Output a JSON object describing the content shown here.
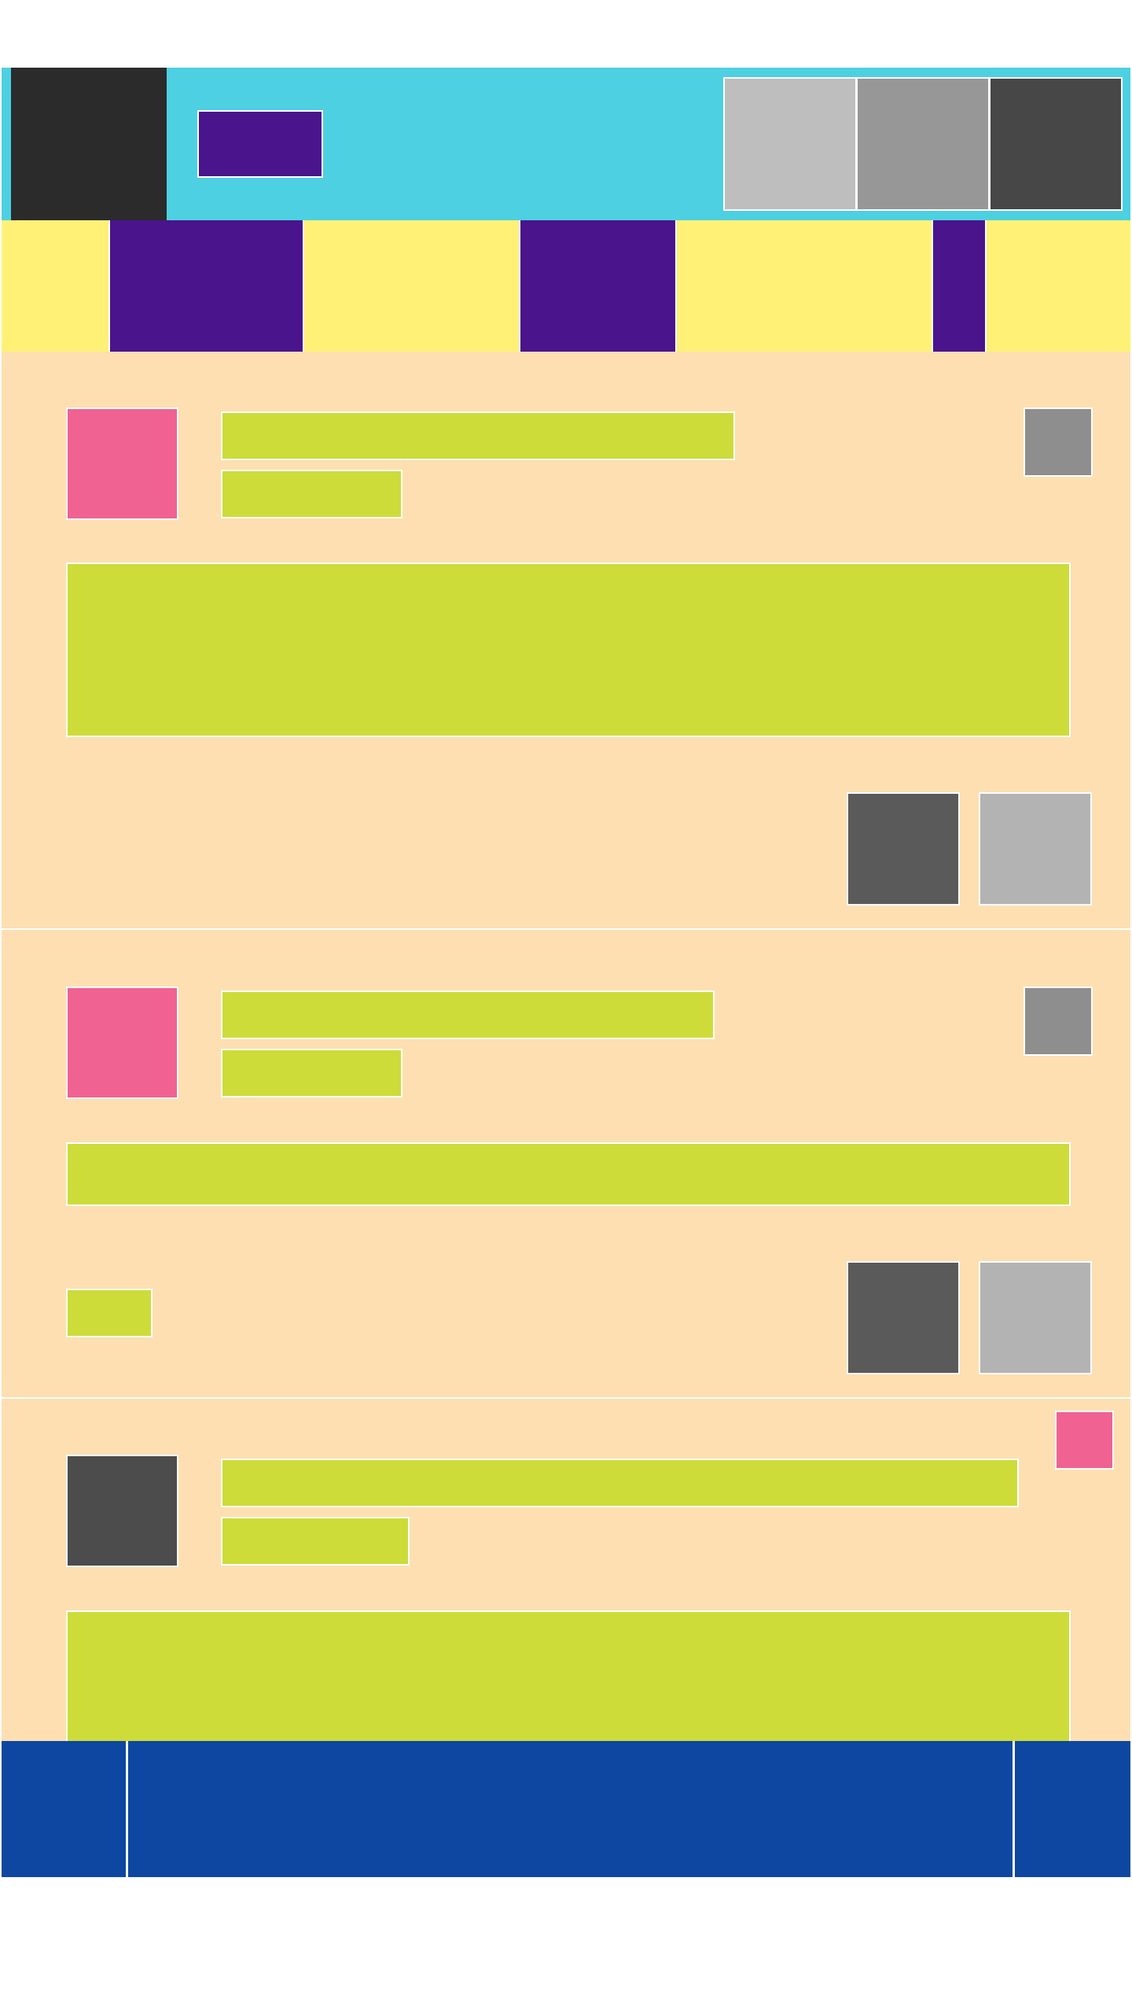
{
  "app_bar": {
    "title": "",
    "nav_icon": "menu-icon",
    "actions": [
      {
        "icon": "action-icon-1"
      },
      {
        "icon": "action-icon-2"
      },
      {
        "icon": "action-icon-3"
      }
    ]
  },
  "tabs": [
    {
      "label": ""
    },
    {
      "label": ""
    },
    {
      "label": ""
    }
  ],
  "cards": [
    {
      "author": "",
      "subtitle": "",
      "body": "",
      "menu_icon": "more-icon"
    },
    {
      "author": "",
      "subtitle": "",
      "body": "",
      "meta": "",
      "menu_icon": "more-icon"
    },
    {
      "author": "",
      "subtitle": "",
      "body": "",
      "badge_icon": "badge-icon"
    }
  ],
  "bottom_bar": {
    "left_icon": "nav-left-icon",
    "right_icon": "nav-right-icon"
  },
  "colors": {
    "app_bar": "#4dd0e1",
    "tab_bar": "#fff176",
    "tab_active": "#4a148c",
    "feed_background": "#fddfb2",
    "text_placeholder": "#cddc39",
    "avatar": "#f06292",
    "bottom_bar": "#0d47a1"
  }
}
